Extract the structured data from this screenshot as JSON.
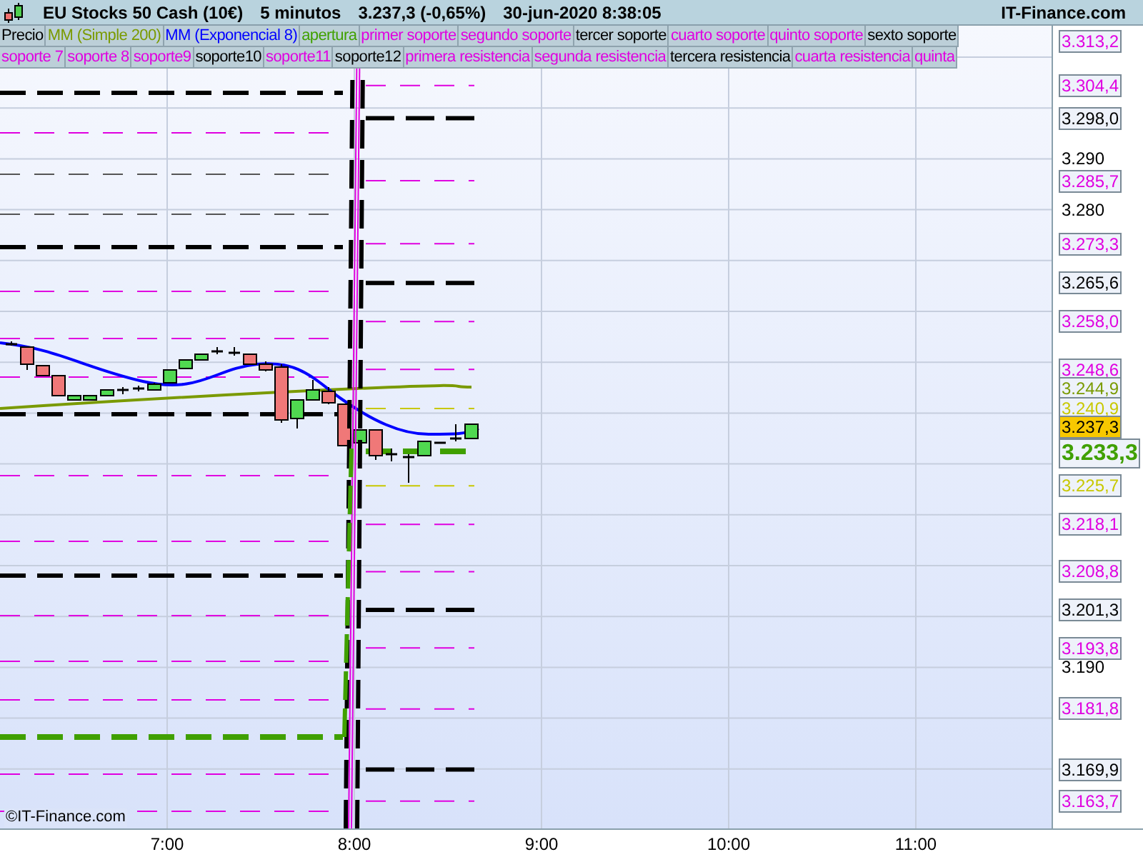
{
  "header": {
    "instrument": "EU Stocks 50 Cash (10€)",
    "timeframe": "5 minutos",
    "quote": "3.237,3 (-0,65%)",
    "datetime": "30-jun-2020 8:38:05",
    "site": "IT-Finance.com"
  },
  "legend": [
    [
      {
        "label": "Precio",
        "color": "#000000"
      },
      {
        "label": "MM (Simple 200)",
        "color": "#7a9a00"
      },
      {
        "label": "MM (Exponencial 8)",
        "color": "#0000ff"
      },
      {
        "label": "apertura",
        "color": "#40a000"
      },
      {
        "label": "primer soporte",
        "color": "#e000e0"
      },
      {
        "label": "segundo soporte",
        "color": "#e000e0"
      },
      {
        "label": "tercer soporte",
        "color": "#000000"
      },
      {
        "label": "cuarto soporte",
        "color": "#e000e0"
      },
      {
        "label": "quinto soporte",
        "color": "#e000e0"
      },
      {
        "label": "sexto soporte",
        "color": "#000000"
      }
    ],
    [
      {
        "label": "soporte 7",
        "color": "#e000e0"
      },
      {
        "label": "soporte 8",
        "color": "#e000e0"
      },
      {
        "label": "soporte9",
        "color": "#e000e0"
      },
      {
        "label": "soporte10",
        "color": "#000000"
      },
      {
        "label": "soporte11",
        "color": "#e000e0"
      },
      {
        "label": "soporte12",
        "color": "#000000"
      },
      {
        "label": "primera resistencia",
        "color": "#e000e0"
      },
      {
        "label": "segunda resistencia",
        "color": "#e000e0"
      },
      {
        "label": "tercera resistencia",
        "color": "#000000"
      },
      {
        "label": "cuarta resistencia",
        "color": "#e000e0"
      },
      {
        "label": "quinta",
        "color": "#e000e0"
      }
    ]
  ],
  "price_ticks": [
    "3.290",
    "3.280",
    "3.190"
  ],
  "price_tags": [
    {
      "label": "3.313,2",
      "kind": "level",
      "color": "#e000e0"
    },
    {
      "label": "3.304,4",
      "kind": "level",
      "color": "#e000e0"
    },
    {
      "label": "3.298,0",
      "kind": "level",
      "color": "#000000"
    },
    {
      "label": "3.285,7",
      "kind": "level",
      "color": "#e000e0"
    },
    {
      "label": "3.273,3",
      "kind": "level",
      "color": "#e000e0"
    },
    {
      "label": "3.265,6",
      "kind": "level",
      "color": "#000000"
    },
    {
      "label": "3.258,0",
      "kind": "level",
      "color": "#e000e0"
    },
    {
      "label": "3.248,6",
      "kind": "level",
      "color": "#e000e0"
    },
    {
      "label": "3.244,9",
      "kind": "average",
      "color": "#7a9a00"
    },
    {
      "label": "3.240,9",
      "kind": "level",
      "color": "#c8c800"
    },
    {
      "label": "3.237,3",
      "kind": "price",
      "color": "#f8c800"
    },
    {
      "label": "3.233,3",
      "kind": "last",
      "color": "#40a000"
    },
    {
      "label": "3.225,7",
      "kind": "level",
      "color": "#c8c800"
    },
    {
      "label": "3.218,1",
      "kind": "level",
      "color": "#e000e0"
    },
    {
      "label": "3.208,8",
      "kind": "level",
      "color": "#e000e0"
    },
    {
      "label": "3.201,3",
      "kind": "level",
      "color": "#000000"
    },
    {
      "label": "3.193,8",
      "kind": "level",
      "color": "#e000e0"
    },
    {
      "label": "3.181,8",
      "kind": "level",
      "color": "#e000e0"
    },
    {
      "label": "3.169,9",
      "kind": "level",
      "color": "#000000"
    },
    {
      "label": "3.163,7",
      "kind": "level",
      "color": "#e000e0"
    }
  ],
  "time_labels": [
    "7:00",
    "8:00",
    "9:00",
    "10:00",
    "11:00"
  ],
  "credit": "©IT-Finance.com"
}
